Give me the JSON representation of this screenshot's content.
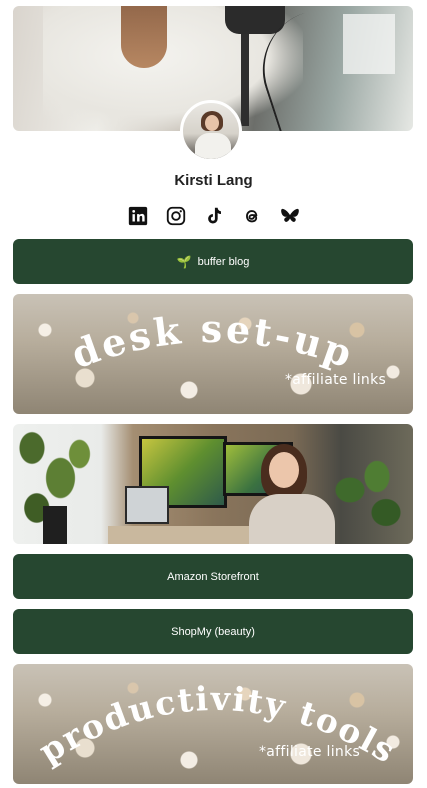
{
  "profile": {
    "name": "Kirsti Lang"
  },
  "social_links": [
    {
      "name": "linkedin",
      "icon": "linkedin-icon"
    },
    {
      "name": "instagram",
      "icon": "instagram-icon"
    },
    {
      "name": "tiktok",
      "icon": "tiktok-icon"
    },
    {
      "name": "threads",
      "icon": "threads-icon"
    },
    {
      "name": "bluesky",
      "icon": "bluesky-icon"
    }
  ],
  "links": {
    "buffer_blog": {
      "label": "buffer blog",
      "icon": "sprout-icon"
    },
    "desk_setup": {
      "title": "desk set-up",
      "note": "*affiliate links"
    },
    "amazon": {
      "label": "Amazon Storefront"
    },
    "shopmy": {
      "label": "ShopMy (beauty)"
    },
    "productivity": {
      "title": "productivity tools",
      "note": "*affiliate links"
    }
  },
  "colors": {
    "button_bg": "#264730",
    "button_text": "#ffffff",
    "name_text": "#222222"
  }
}
